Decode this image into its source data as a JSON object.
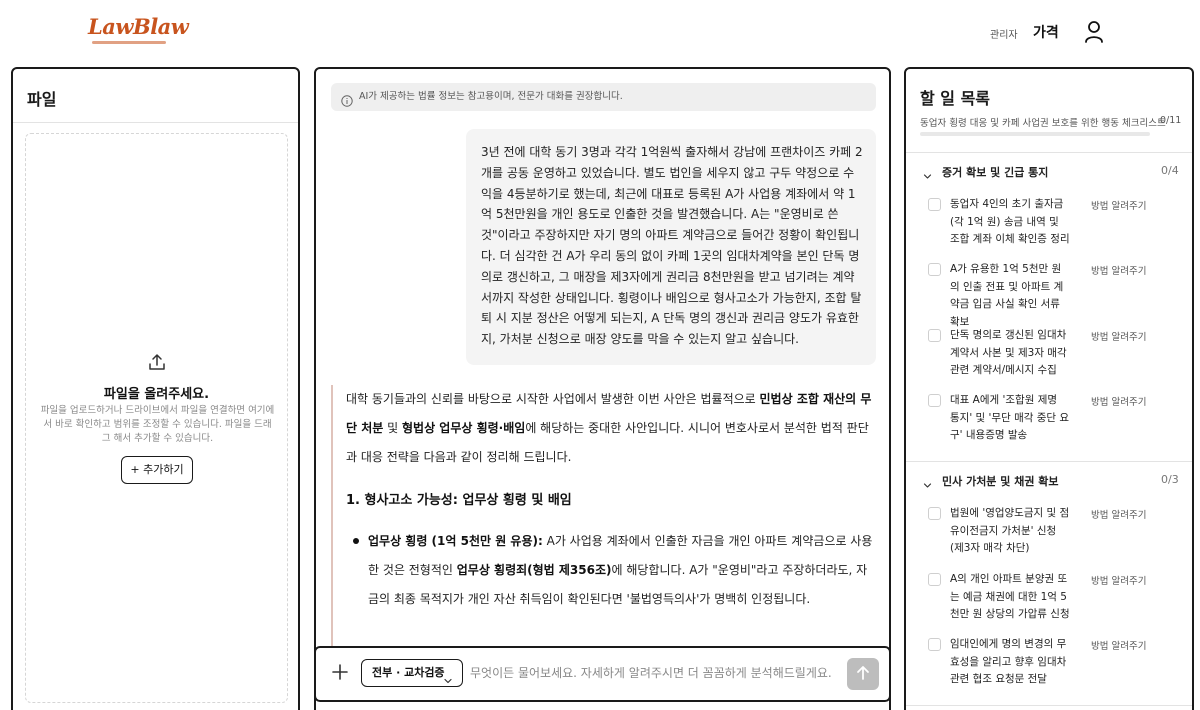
{
  "header": {
    "logo": "LawBlaw",
    "admin_label": "관리자",
    "price_label": "가격"
  },
  "files_panel": {
    "title": "파일",
    "dropzone_title": "파일을 올려주세요.",
    "dropzone_desc": "파일을 업로드하거나 드라이브에서 파일을 연결하면 여기에서 바로 확인하고 범위를 조정할 수 있습니다. 파일을 드래그 해서 추가할 수 있습니다.",
    "add_button": "+ 추가하기"
  },
  "chat": {
    "notice": "AI가 제공하는 법률 정보는 참고용이며, 전문가 대화를 권장합니다.",
    "user_message": "3년 전에 대학 동기 3명과 각각 1억원씩 출자해서 강남에 프랜차이즈 카페 2개를 공동 운영하고 있었습니다. 별도 법인을 세우지 않고 구두 약정으로 수익을 4등분하기로 했는데, 최근에 대표로 등록된 A가 사업용 계좌에서 약 1억 5천만원을 개인 용도로 인출한 것을 발견했습니다. A는 \"운영비로 쓴 것\"이라고 주장하지만 자기 명의 아파트 계약금으로 들어간 정황이 확인됩니다. 더 심각한 건 A가 우리 동의 없이 카페 1곳의 임대차계약을 본인 단독 명의로 갱신하고, 그 매장을 제3자에게 권리금 8천만원을 받고 넘기려는 계약서까지 작성한 상태입니다. 횡령이나 배임으로 형사고소가 가능한지, 조합 탈퇴 시 지분 정산은 어떻게 되는지, A 단독 명의 갱신과 권리금 양도가 유효한지, 가처분 신청으로 매장 양도를 막을 수 있는지 알고 싶습니다.",
    "answer": {
      "p1_a": "대학 동기들과의 신뢰를 바탕으로 시작한 사업에서 발생한 이번 사안은 법률적으로 ",
      "p1_b1": "민법상 조합 재산의 무단 처분",
      "p1_c": " 및 ",
      "p1_b2": "형법상 업무상 횡령·배임",
      "p1_d": "에 해당하는 중대한 사안입니다. 시니어 변호사로서 분석한 법적 판단과 대응 전략을 다음과 같이 정리해 드립니다.",
      "heading1": "1. 형사고소 가능성: 업무상 횡령 및 배임",
      "bullet1_b1": "업무상 횡령 (1억 5천만 원 유용):",
      "bullet1_a": " A가 사업용 계좌에서 인출한 자금을 개인 아파트 계약금으로 사용한 것은 전형적인 ",
      "bullet1_b2": "업무상 횡령죄(형법 제356조)",
      "bullet1_c": "에 해당합니다. A가 \"운영비\"라고 주장하더라도, 자금의 최종 목적지가 개인 자산 취득임이 확인된다면 '불법영득의사'가 명백히 인정됩니다."
    },
    "mode_label": "전부 · 교차검증",
    "input_placeholder": "무엇이든 물어보세요. 자세하게 알려주시면 더 꼼꼼하게 분석해드릴게요."
  },
  "todo": {
    "title": "할 일 목록",
    "subtitle": "동업자 횡령 대응 및 카페 사업권 보호를 위한 행동 체크리스트",
    "progress_text": "0/11",
    "progress_fraction": 0,
    "how_label": "방법 알려주기",
    "sections": [
      {
        "title": "증거 확보 및 긴급 통지",
        "count": "0/4",
        "tasks": [
          "동업자 4인의 초기 출자금(각 1억 원) 송금 내역 및 조합 계좌 이체 확인증 정리",
          "A가 유용한 1억 5천만 원의 인출 전표 및 아파트 계약금 입금 사실 확인 서류 확보",
          "단독 명의로 갱신된 임대차 계약서 사본 및 제3자 매각 관련 계약서/메시지 수집",
          "대표 A에게 '조합원 제명 통지' 및 '무단 매각 중단 요구' 내용증명 발송"
        ]
      },
      {
        "title": "민사 가처분 및 채권 확보",
        "count": "0/3",
        "tasks": [
          "법원에 '영업양도금지 및 점유이전금지 가처분' 신청 (제3자 매각 차단)",
          "A의 개인 아파트 분양권 또는 예금 채권에 대한 1억 5천만 원 상당의 가압류 신청",
          "임대인에게 명의 변경의 무효성을 알리고 향후 임대차 관련 협조 요청문 전달"
        ]
      }
    ]
  }
}
